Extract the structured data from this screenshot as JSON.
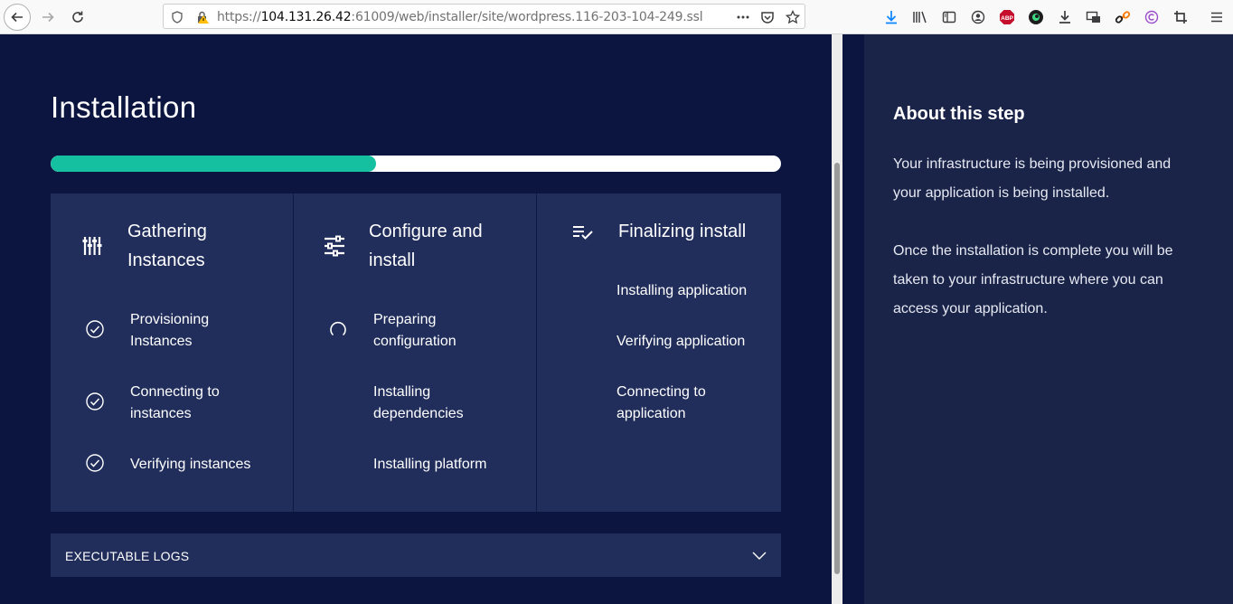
{
  "browser": {
    "url_prefix": "https://",
    "url_host": "104.131.26.42",
    "url_rest": ":61009/web/installer/site/wordpress.116-203-104-249.ssl",
    "icons": [
      "back-icon",
      "forward-icon",
      "reload-icon",
      "shield-icon",
      "warning-icon",
      "more-icon",
      "pocket-icon",
      "star-icon",
      "download-icon",
      "library-icon",
      "sidebar-icon",
      "account-icon",
      "adblock-icon",
      "extension-icon",
      "download-arrow-icon",
      "screenshot-icon",
      "link-icon",
      "copyright-icon",
      "crop-icon",
      "menu-icon"
    ],
    "adblock_label": "ABP"
  },
  "installer": {
    "title": "Installation",
    "progress": 0.445,
    "accent_color": "#15c0a0",
    "phases": [
      {
        "icon": "sliders-vertical-icon",
        "title_line1": "Gathering",
        "title_line2": "Instances",
        "steps": [
          {
            "line1": "Provisioning",
            "line2": "Instances",
            "status": "done"
          },
          {
            "line1": "Connecting to",
            "line2": "instances",
            "status": "done"
          },
          {
            "line1": "Verifying instances",
            "line2": "",
            "status": "done"
          }
        ]
      },
      {
        "icon": "sliders-horizontal-icon",
        "title_line1": "Configure and",
        "title_line2": "install",
        "steps": [
          {
            "line1": "Preparing",
            "line2": "configuration",
            "status": "in-progress"
          },
          {
            "line1": "Installing",
            "line2": "dependencies",
            "status": "pending"
          },
          {
            "line1": "Installing platform",
            "line2": "",
            "status": "pending"
          }
        ]
      },
      {
        "icon": "checklist-icon",
        "title_line1": "Finalizing install",
        "title_line2": "",
        "steps": [
          {
            "line1": "Installing application",
            "line2": "",
            "status": "pending"
          },
          {
            "line1": "Verifying application",
            "line2": "",
            "status": "pending"
          },
          {
            "line1": "Connecting to",
            "line2": "application",
            "status": "pending"
          }
        ]
      }
    ],
    "logs_label": "EXECUTABLE LOGS"
  },
  "about": {
    "title": "About this step",
    "p1_line1": "Your infrastructure is being provisioned and",
    "p1_line2": "your application is being installed.",
    "p2_line1": "Once the installation is complete you will be",
    "p2_line2": "taken to your infrastructure where you can",
    "p2_line3": "access your application."
  }
}
